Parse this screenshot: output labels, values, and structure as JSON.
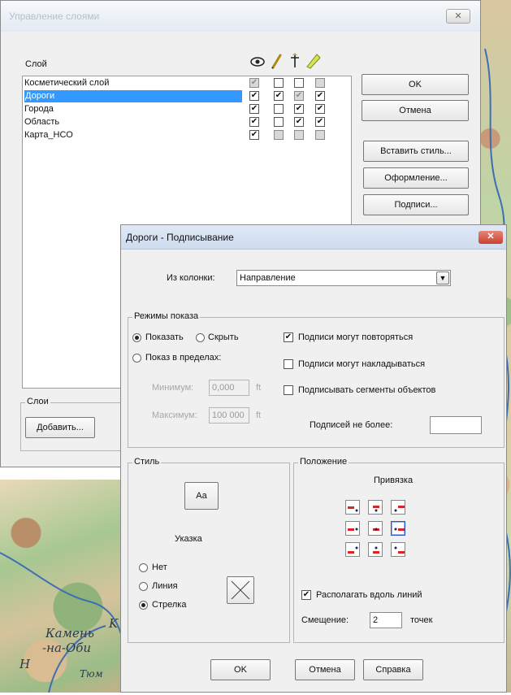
{
  "map": {
    "labels": [
      "Камень",
      "-на-Оби",
      "Тюм",
      "Н",
      "K"
    ]
  },
  "layer_dialog": {
    "title": "Управление слоями",
    "close_glyph": "✕",
    "list_header": "Слой",
    "column_icons": [
      "eye-icon",
      "pencil-icon",
      "pointer-icon",
      "label-tag-icon"
    ],
    "layers": [
      {
        "name": "Косметический слой",
        "checks": [
          "grey-checked",
          "off",
          "off",
          "grey"
        ],
        "selected": false
      },
      {
        "name": "Дороги",
        "checks": [
          "on",
          "on",
          "grey-checked",
          "on"
        ],
        "selected": true
      },
      {
        "name": "Города",
        "checks": [
          "on",
          "off",
          "on",
          "on"
        ],
        "selected": false
      },
      {
        "name": "Область",
        "checks": [
          "on",
          "off",
          "on",
          "on"
        ],
        "selected": false
      },
      {
        "name": "Карта_НСО",
        "checks": [
          "on",
          "grey",
          "grey",
          "grey"
        ],
        "selected": false
      }
    ],
    "buttons": {
      "ok": "OK",
      "cancel": "Отмена",
      "paste_style": "Вставить стиль...",
      "display": "Оформление...",
      "labels": "Подписи..."
    },
    "layers_group": "Слои",
    "add_button": "Добавить..."
  },
  "label_dialog": {
    "title": "Дороги - Подписывание",
    "close_glyph": "✕",
    "column": {
      "label": "Из колонки:",
      "value": "Направление"
    },
    "display_mode": {
      "group_label": "Режимы показа",
      "show": "Показать",
      "hide": "Скрыть",
      "in_range": "Показ в пределах:",
      "min_label": "Минимум:",
      "min_value": "0,000",
      "min_unit": "ft",
      "max_label": "Максимум:",
      "max_value": "100 000",
      "max_unit": "ft",
      "allow_duplicates": "Подписи могут повторяться",
      "allow_overlap": "Подписи могут накладываться",
      "label_segments": "Подписывать сегменты объектов",
      "max_labels": "Подписей не более:",
      "max_labels_value": ""
    },
    "style": {
      "group_label": "Стиль",
      "font_button": "Аа",
      "callout_label": "Указка",
      "none": "Нет",
      "line": "Линия",
      "arrow": "Стрелка"
    },
    "position": {
      "group_label": "Положение",
      "anchor_label": "Привязка",
      "along_lines": "Располагать вдоль линий",
      "offset_label": "Смещение:",
      "offset_value": "2",
      "offset_unit": "точек"
    },
    "buttons": {
      "ok": "OK",
      "cancel": "Отмена",
      "help": "Справка"
    }
  }
}
